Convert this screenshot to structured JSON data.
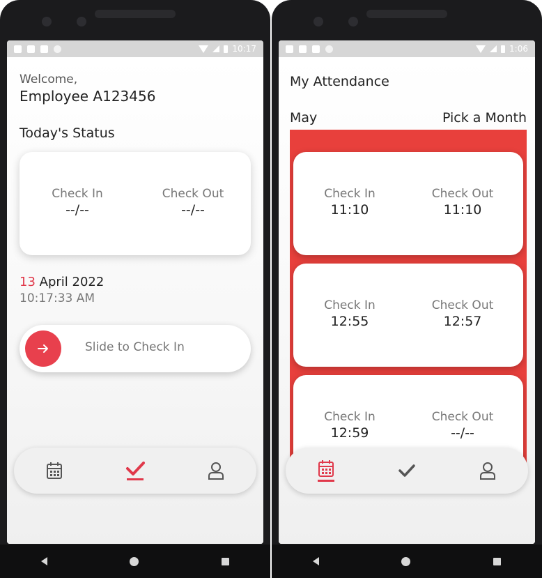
{
  "left": {
    "status_time": "10:17",
    "welcome": "Welcome,",
    "employee": "Employee A123456",
    "section_title": "Today's Status",
    "status_card": {
      "check_in_label": "Check In",
      "check_in_value": "--/--",
      "check_out_label": "Check Out",
      "check_out_value": "--/--"
    },
    "date_day": "13",
    "date_rest": "April 2022",
    "time": "10:17:33 AM",
    "slider_text": "Slide to Check In",
    "slider_icon": "arrow-right-icon",
    "active_tab": "check"
  },
  "right": {
    "status_time": "1:06",
    "title": "My Attendance",
    "month": "May",
    "pick_month": "Pick a Month",
    "records": [
      {
        "check_in_label": "Check In",
        "check_in": "11:10",
        "check_out_label": "Check Out",
        "check_out": "11:10"
      },
      {
        "check_in_label": "Check In",
        "check_in": "12:55",
        "check_out_label": "Check Out",
        "check_out": "12:57"
      },
      {
        "check_in_label": "Check In",
        "check_in": "12:59",
        "check_out_label": "Check Out",
        "check_out": "--/--"
      }
    ],
    "active_tab": "calendar"
  },
  "colors": {
    "accent": "#e0384a",
    "panel_red": "#e8403c",
    "inactive_icon": "#555555"
  }
}
